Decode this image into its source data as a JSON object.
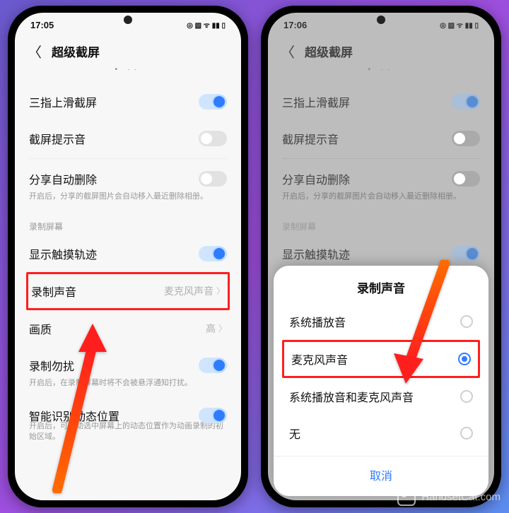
{
  "left": {
    "status_time": "17:05",
    "header_title": "超级截屏",
    "rows": {
      "three_finger": {
        "label": "三指上滑截屏"
      },
      "shutter_sound": {
        "label": "截屏提示音"
      },
      "auto_delete": {
        "label": "分享自动删除",
        "desc": "开启后，分享的截屏图片会自动移入最近删除相册。"
      },
      "section": "录制屏幕",
      "show_touch": {
        "label": "显示触摸轨迹"
      },
      "record_audio": {
        "label": "录制声音",
        "value": "麦克风声音"
      },
      "quality": {
        "label": "画质",
        "value": "高"
      },
      "dnd": {
        "label": "录制勿扰",
        "desc": "开启后，在录制屏幕时将不会被悬浮通知打扰。"
      },
      "auto_detect": {
        "label": "智能识别动态位置",
        "desc": "开启后，可自动选中屏幕上的动态位置作为动画录制的初始区域。"
      }
    }
  },
  "right": {
    "status_time": "17:06",
    "header_title": "超级截屏",
    "rows": {
      "three_finger": {
        "label": "三指上滑截屏"
      },
      "shutter_sound": {
        "label": "截屏提示音"
      },
      "auto_delete": {
        "label": "分享自动删除",
        "desc": "开启后，分享的截屏图片会自动移入最近删除相册。"
      },
      "section": "录制屏幕",
      "show_touch": {
        "label": "显示触摸轨迹"
      }
    },
    "modal": {
      "title": "录制声音",
      "opt_system": "系统播放音",
      "opt_mic": "麦克风声音",
      "opt_both": "系统播放音和麦克风声音",
      "opt_none": "无",
      "cancel": "取消"
    }
  },
  "watermark": "HandsetCat.com"
}
